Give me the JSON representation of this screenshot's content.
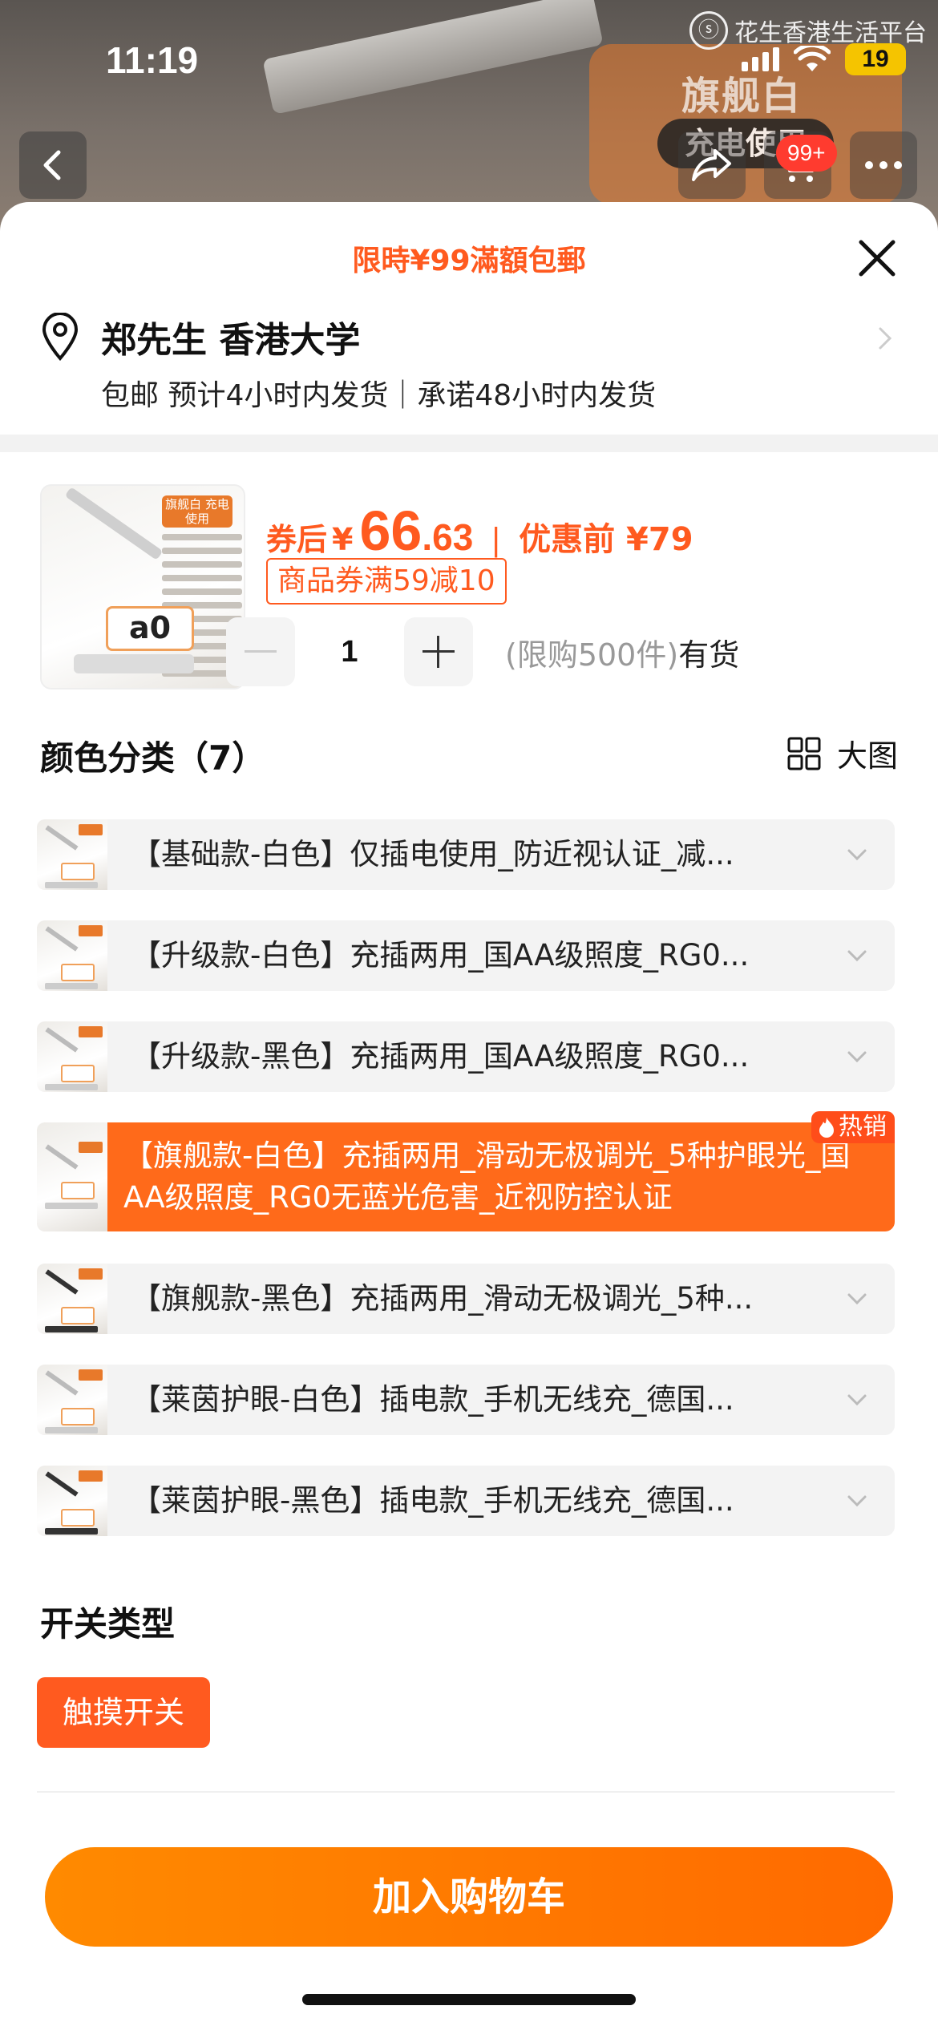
{
  "status_bar": {
    "time": "11:19",
    "battery": "19"
  },
  "watermark": {
    "text": "花生香港生活平台",
    "logo_glyph": "ⓢ"
  },
  "background": {
    "panel_text": "旗舰白",
    "panel_pill": "充电使用"
  },
  "nav": {
    "cart_badge": "99+"
  },
  "sheet": {
    "promo": "限時¥99滿額包郵",
    "address": {
      "name": "郑先生 香港大学",
      "shipping": "包邮 预计4小时内发货｜承诺48小时内发货"
    },
    "product": {
      "price_label": "券后",
      "currency": "¥",
      "price_int": "66",
      "price_dec": ".63",
      "separator": "|",
      "original_label": "优惠前 ¥79",
      "coupon": "商品券满59减10",
      "thumb_tag": "旗舰白 充电使用",
      "thumb_clock": "a0",
      "quantity": "1",
      "limit": "(限购500件)",
      "stock": "有货"
    },
    "color_section": {
      "title": "颜色分类（7）",
      "big_view": "大图",
      "options": [
        {
          "label": "【基础款-白色】仅插电使用_防近视认证_减...",
          "selected": false
        },
        {
          "label": "【升级款-白色】充插两用_国AA级照度_RG0...",
          "selected": false
        },
        {
          "label": "【升级款-黑色】充插两用_国AA级照度_RG0...",
          "selected": false
        },
        {
          "label": "【旗舰款-白色】充插两用_滑动无极调光_5种护眼光_国AA级照度_RG0无蓝光危害_近视防控认证",
          "selected": true,
          "badge": "热销"
        },
        {
          "label": "【旗舰款-黑色】充插两用_滑动无极调光_5种...",
          "selected": false
        },
        {
          "label": "【莱茵护眼-白色】插电款_手机无线充_德国...",
          "selected": false
        },
        {
          "label": "【莱茵护眼-黑色】插电款_手机无线充_德国...",
          "selected": false
        }
      ]
    },
    "switch_section": {
      "title": "开关类型",
      "chip": "触摸开关"
    },
    "cta": "加入购物车"
  },
  "colors": {
    "accent": "#ff5a1f",
    "selected_bg": "#ff6a1a",
    "cta": "#ff7a00",
    "hot": "#ff4d1a"
  }
}
